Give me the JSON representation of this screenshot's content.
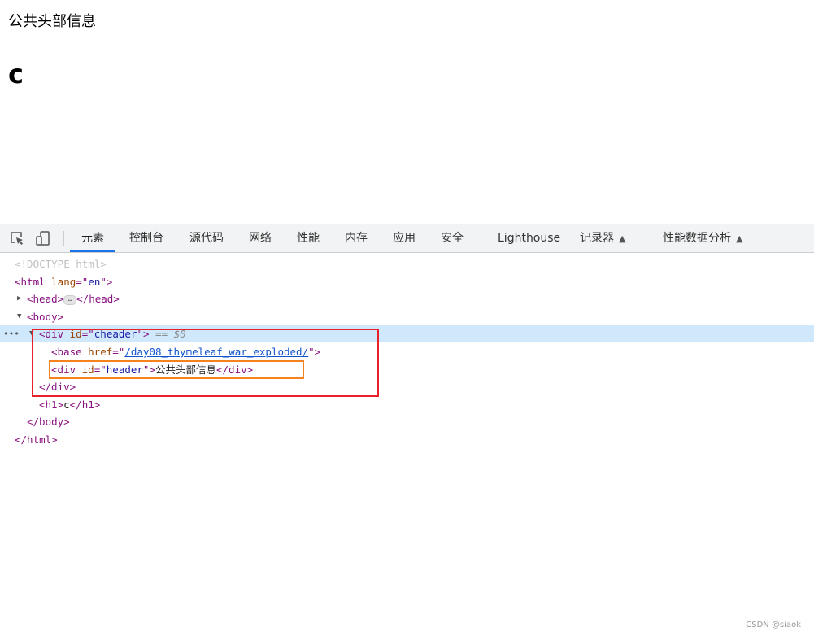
{
  "page": {
    "header_text": "公共头部信息",
    "h1_text": "c"
  },
  "devtools": {
    "tabs": [
      {
        "label": "元素",
        "active": true
      },
      {
        "label": "控制台"
      },
      {
        "label": "源代码"
      },
      {
        "label": "网络"
      },
      {
        "label": "性能"
      },
      {
        "label": "内存"
      },
      {
        "label": "应用"
      },
      {
        "label": "安全"
      },
      {
        "label": "Lighthouse"
      },
      {
        "label": "记录器",
        "experimental": true
      },
      {
        "label": "性能数据分析",
        "experimental": true
      }
    ],
    "icons": [
      "inspect-element-icon",
      "device-toolbar-icon",
      "flask-icon"
    ],
    "dom_lines": [
      {
        "indent": 0,
        "segs": [
          [
            "dt",
            "<!DOCTYPE html>"
          ]
        ]
      },
      {
        "indent": 0,
        "segs": [
          [
            "tg",
            "<html "
          ],
          [
            "an",
            "lang"
          ],
          [
            "tg",
            "=\""
          ],
          [
            "av",
            "en"
          ],
          [
            "tg",
            "\">"
          ]
        ]
      },
      {
        "indent": 1,
        "toggle": "collapsed",
        "segs": [
          [
            "tg",
            "<head>"
          ],
          [
            "badge",
            "…"
          ],
          [
            "tg",
            "</head>"
          ]
        ]
      },
      {
        "indent": 1,
        "toggle": "expanded",
        "segs": [
          [
            "tg",
            "<body>"
          ]
        ]
      },
      {
        "indent": 2,
        "toggle": "expanded",
        "selected": true,
        "segs": [
          [
            "tg",
            "<div "
          ],
          [
            "an",
            "id"
          ],
          [
            "tg",
            "=\""
          ],
          [
            "av",
            "cheader"
          ],
          [
            "tg",
            "\">"
          ],
          [
            "eq",
            " == $0"
          ]
        ]
      },
      {
        "indent": 3,
        "segs": [
          [
            "tg",
            "<base "
          ],
          [
            "an",
            "href"
          ],
          [
            "tg",
            "=\""
          ],
          [
            "lk",
            "/day08_thymeleaf_war_exploded/"
          ],
          [
            "tg",
            "\">"
          ]
        ]
      },
      {
        "indent": 3,
        "segs": [
          [
            "tg",
            "<div "
          ],
          [
            "an",
            "id"
          ],
          [
            "tg",
            "=\""
          ],
          [
            "av",
            "header"
          ],
          [
            "tg",
            "\">"
          ],
          [
            "tx",
            "公共头部信息"
          ],
          [
            "tg",
            "</div>"
          ]
        ]
      },
      {
        "indent": 2,
        "segs": [
          [
            "tg",
            "</div>"
          ]
        ]
      },
      {
        "indent": 2,
        "segs": [
          [
            "tg",
            "<h1>"
          ],
          [
            "tx",
            "c"
          ],
          [
            "tg",
            "</h1>"
          ]
        ]
      },
      {
        "indent": 1,
        "segs": [
          [
            "tg",
            "</body>"
          ]
        ]
      },
      {
        "indent": 0,
        "segs": [
          [
            "tg",
            "</html>"
          ]
        ]
      }
    ],
    "selected_row_menu": "•••"
  },
  "colors": {
    "tab_active": "#1a73e8",
    "selection": "#cfe8fc",
    "highlight_red": "#e8202a",
    "highlight_orange": "#f5821f"
  },
  "watermark": "CSDN @siaok"
}
